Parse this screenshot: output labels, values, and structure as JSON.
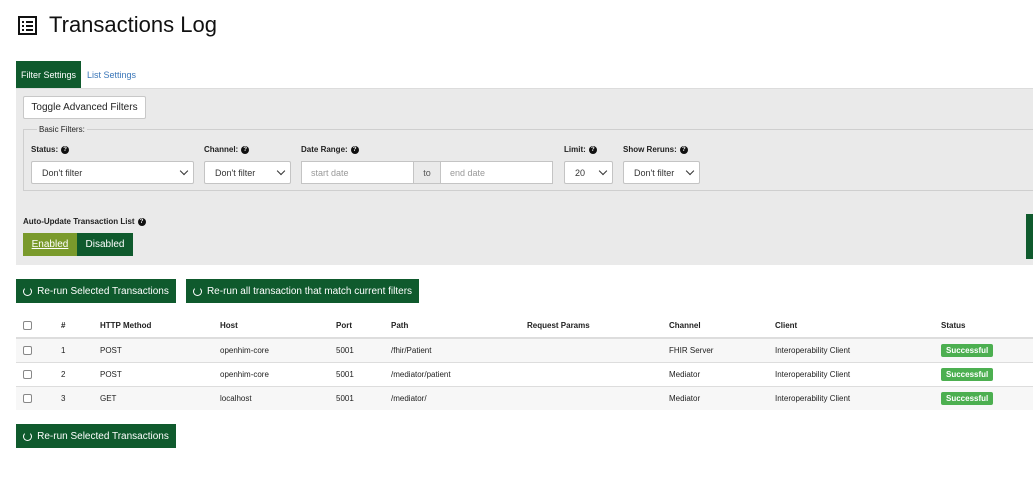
{
  "header": {
    "title": "Transactions Log",
    "icon": "list-icon"
  },
  "tabs": [
    {
      "label": "Filter Settings",
      "active": true
    },
    {
      "label": "List Settings",
      "active": false
    }
  ],
  "filters": {
    "toggle_advanced": "Toggle Advanced Filters",
    "basic_legend": "Basic Filters:",
    "status": {
      "label": "Status:",
      "value": "Don't filter"
    },
    "channel": {
      "label": "Channel:",
      "value": "Don't filter"
    },
    "date_range": {
      "label": "Date Range:",
      "start_placeholder": "start date",
      "to": "to",
      "end_placeholder": "end date"
    },
    "limit": {
      "label": "Limit:",
      "value": "20"
    },
    "show_reruns": {
      "label": "Show Reruns:",
      "value": "Don't filter"
    },
    "auto_update": {
      "label": "Auto-Update Transaction List",
      "enabled": "Enabled",
      "disabled": "Disabled",
      "selected": "Enabled"
    }
  },
  "actions": {
    "rerun_selected": "Re-run Selected Transactions",
    "rerun_all": "Re-run all transaction that match current filters",
    "rerun_selected_bottom": "Re-run Selected Transactions"
  },
  "table": {
    "headers": [
      "#",
      "HTTP Method",
      "Host",
      "Port",
      "Path",
      "Request Params",
      "Channel",
      "Client",
      "Status"
    ],
    "rows": [
      {
        "num": "1",
        "method": "POST",
        "host": "openhim-core",
        "port": "5001",
        "path": "/fhir/Patient",
        "params": "",
        "channel": "FHIR Server",
        "client": "Interoperability Client",
        "status": "Successful"
      },
      {
        "num": "2",
        "method": "POST",
        "host": "openhim-core",
        "port": "5001",
        "path": "/mediator/patient",
        "params": "",
        "channel": "Mediator",
        "client": "Interoperability Client",
        "status": "Successful"
      },
      {
        "num": "3",
        "method": "GET",
        "host": "localhost",
        "port": "5001",
        "path": "/mediator/",
        "params": "",
        "channel": "Mediator",
        "client": "Interoperability Client",
        "status": "Successful"
      }
    ]
  },
  "colors": {
    "primary": "#0f5a2d",
    "enabled_toggle": "#7a9a2c",
    "success": "#4caf50",
    "link": "#3a76b8",
    "panel": "#eaeaea"
  }
}
